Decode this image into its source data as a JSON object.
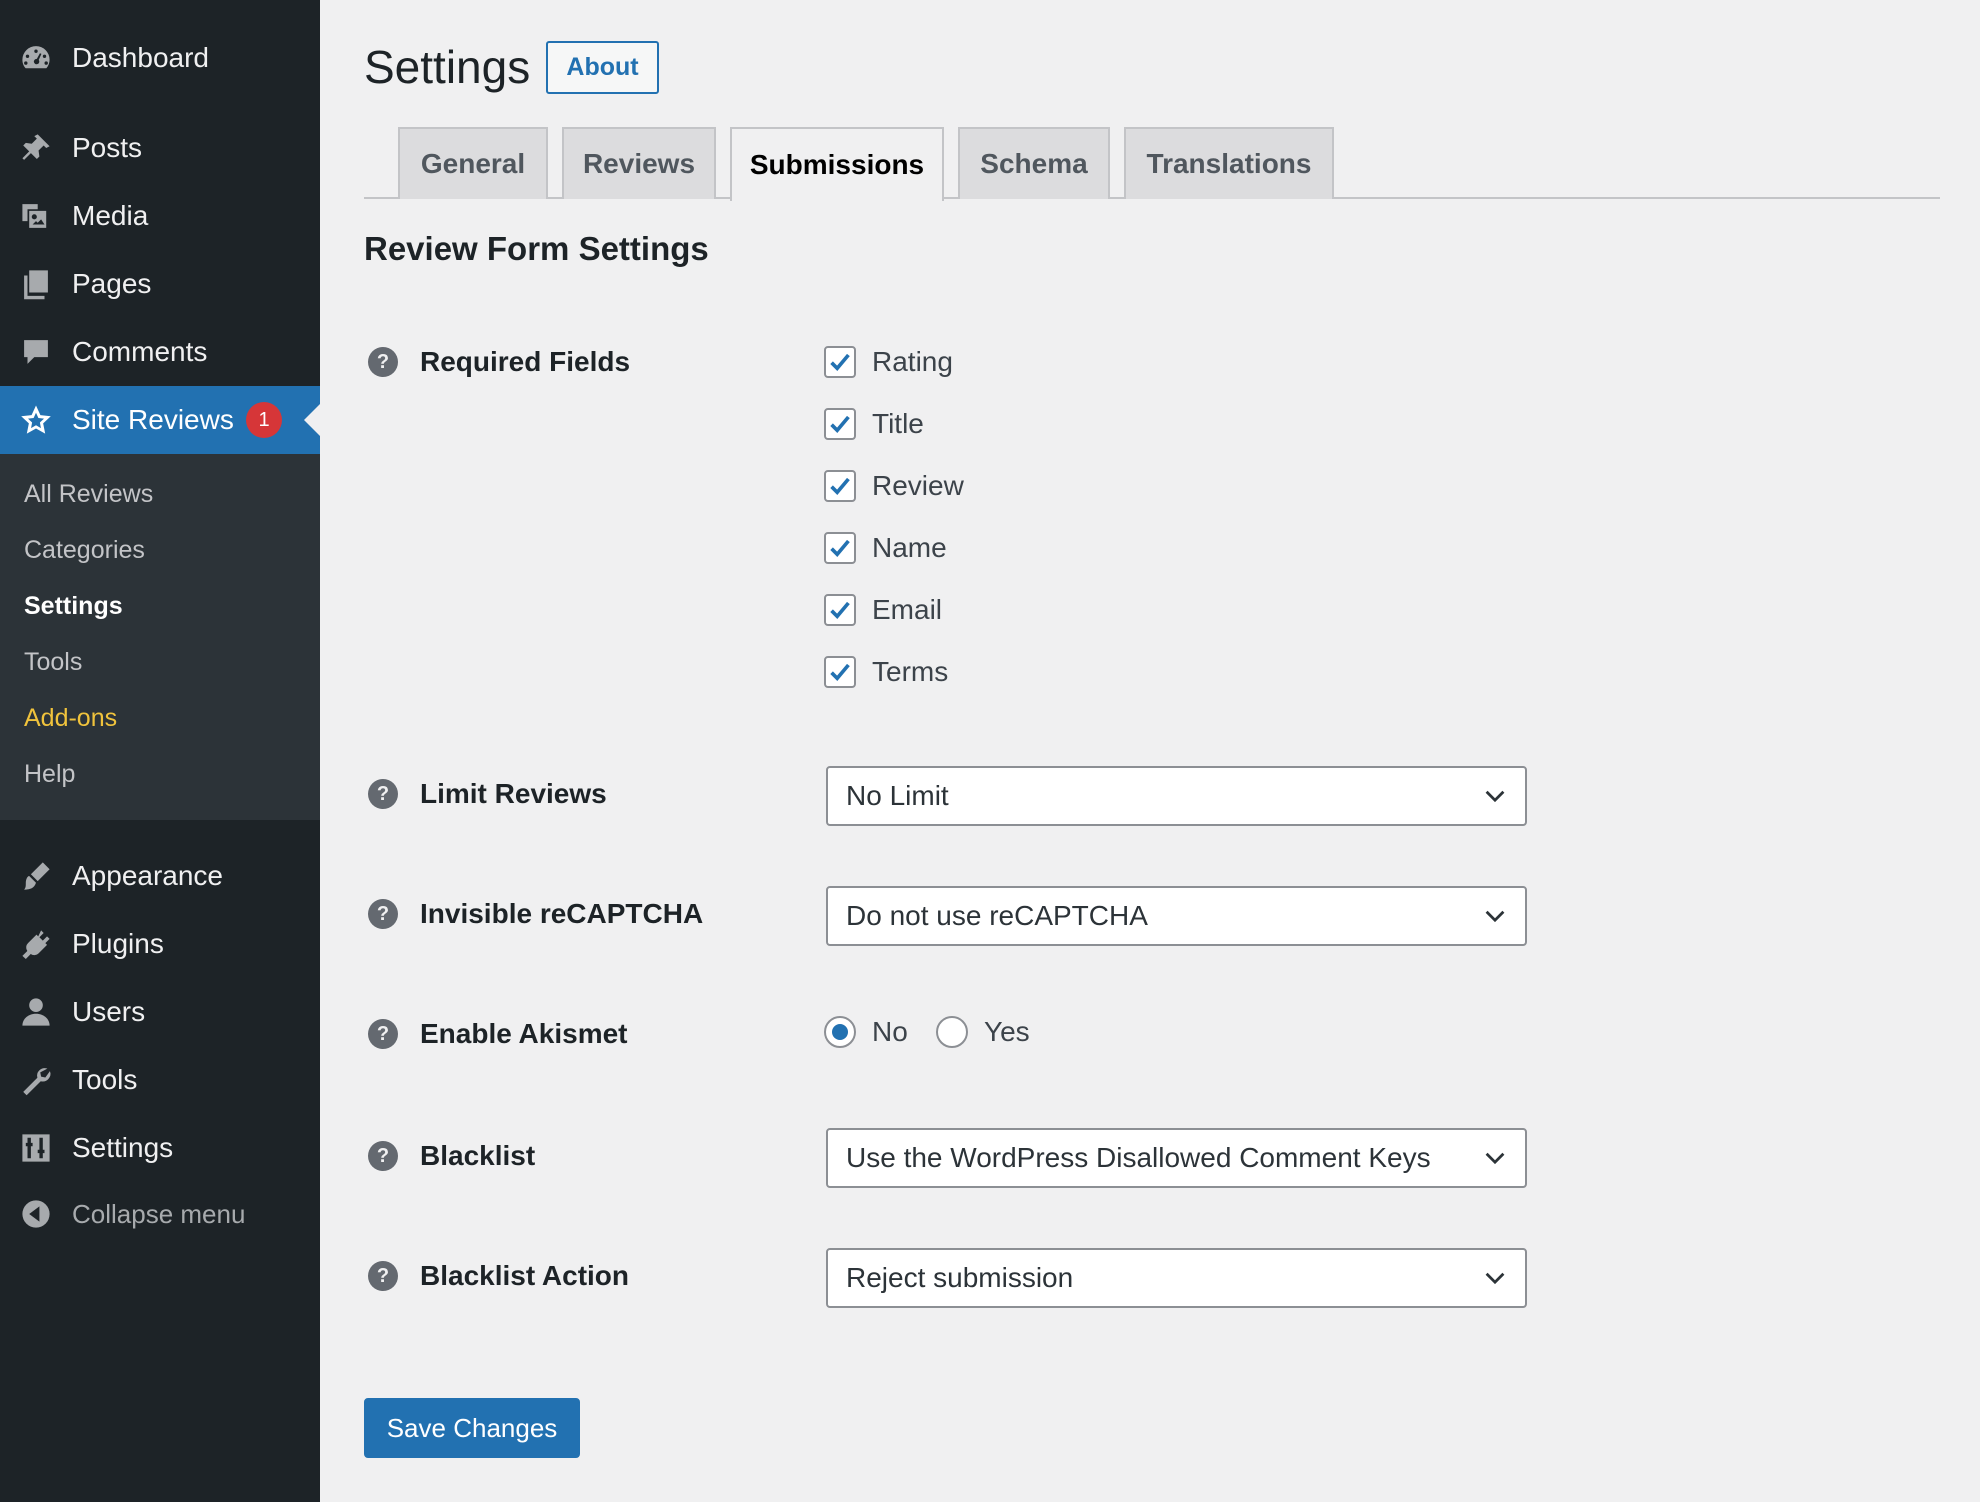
{
  "sidebar": {
    "items_top": [
      {
        "label": "Dashboard",
        "icon": "dashboard-icon"
      }
    ],
    "items": [
      {
        "label": "Posts",
        "icon": "pin-icon"
      },
      {
        "label": "Media",
        "icon": "media-icon"
      },
      {
        "label": "Pages",
        "icon": "pages-icon"
      },
      {
        "label": "Comments",
        "icon": "comment-icon"
      }
    ],
    "active": {
      "label": "Site Reviews",
      "icon": "star-icon",
      "badge": "1"
    },
    "submenu": [
      {
        "label": "All Reviews"
      },
      {
        "label": "Categories"
      },
      {
        "label": "Settings"
      },
      {
        "label": "Tools"
      },
      {
        "label": "Add-ons"
      },
      {
        "label": "Help"
      }
    ],
    "items_bottom": [
      {
        "label": "Appearance",
        "icon": "brush-icon"
      },
      {
        "label": "Plugins",
        "icon": "plugin-icon"
      },
      {
        "label": "Users",
        "icon": "user-icon"
      },
      {
        "label": "Tools",
        "icon": "wrench-icon"
      },
      {
        "label": "Settings",
        "icon": "sliders-icon"
      }
    ],
    "collapse_label": "Collapse menu"
  },
  "header": {
    "title": "Settings",
    "about_label": "About"
  },
  "tabs": [
    {
      "label": "General"
    },
    {
      "label": "Reviews"
    },
    {
      "label": "Submissions"
    },
    {
      "label": "Schema"
    },
    {
      "label": "Translations"
    }
  ],
  "active_tab": "Submissions",
  "section": {
    "title": "Review Form Settings"
  },
  "help_glyph": "?",
  "fields": {
    "required": {
      "label": "Required Fields",
      "options": [
        {
          "label": "Rating",
          "checked": true
        },
        {
          "label": "Title",
          "checked": true
        },
        {
          "label": "Review",
          "checked": true
        },
        {
          "label": "Name",
          "checked": true
        },
        {
          "label": "Email",
          "checked": true
        },
        {
          "label": "Terms",
          "checked": true
        }
      ]
    },
    "limit": {
      "label": "Limit Reviews",
      "value": "No Limit"
    },
    "recaptcha": {
      "label": "Invisible reCAPTCHA",
      "value": "Do not use reCAPTCHA"
    },
    "akismet": {
      "label": "Enable Akismet",
      "options": [
        {
          "label": "No",
          "checked": true
        },
        {
          "label": "Yes",
          "checked": false
        }
      ]
    },
    "blacklist": {
      "label": "Blacklist",
      "value": "Use the WordPress Disallowed Comment Keys"
    },
    "blacklist_action": {
      "label": "Blacklist Action",
      "value": "Reject submission"
    }
  },
  "save_label": "Save Changes",
  "colors": {
    "sidebar_bg": "#1d2327",
    "submenu_bg": "#2c3338",
    "accent": "#2271b1",
    "badge": "#d63638",
    "addons": "#f0c33c",
    "page_bg": "#f0f0f1"
  }
}
